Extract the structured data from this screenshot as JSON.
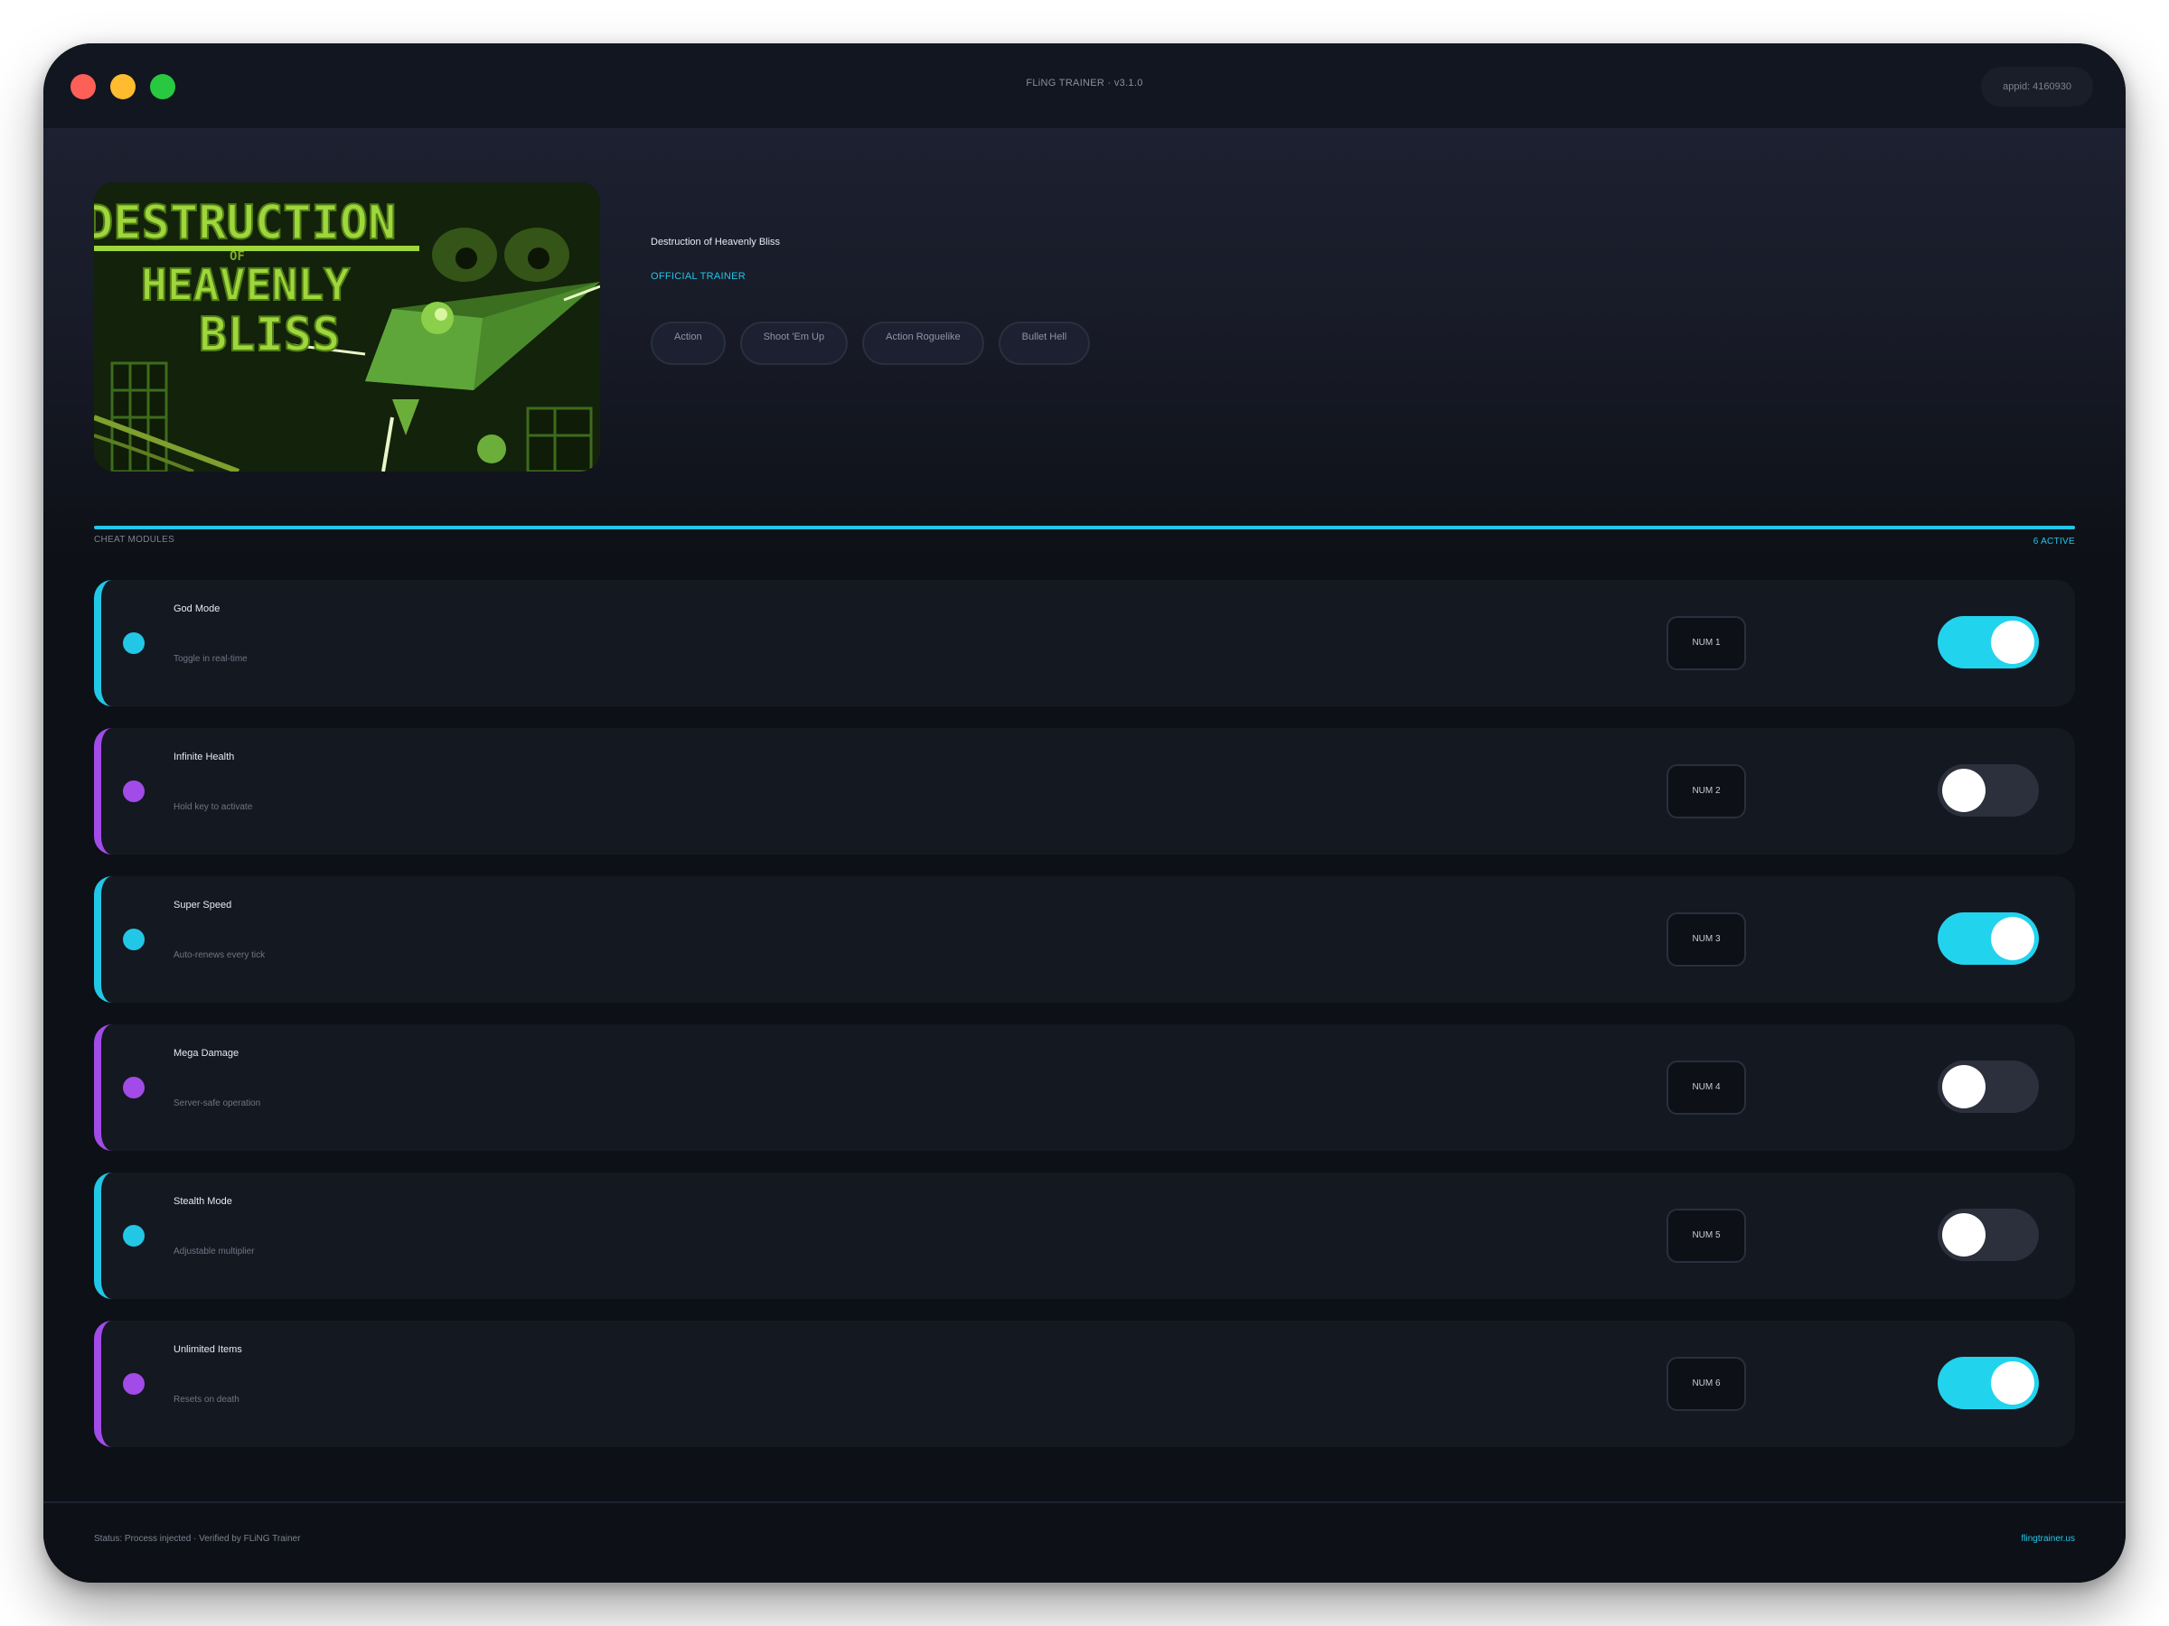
{
  "titlebar": {
    "title": "FLiNG TRAINER · v3.1.0",
    "appid": "appid: 4160930"
  },
  "game": {
    "title": "Destruction of Heavenly Bliss",
    "badge": "OFFICIAL TRAINER",
    "cover_title_lines": [
      "DESTRUCTION",
      "OF",
      "HEAVENLY",
      "BLISS"
    ],
    "tags": [
      "Action",
      "Shoot 'Em Up",
      "Action Roguelike",
      "Bullet Hell"
    ]
  },
  "modules_header": {
    "label": "CHEAT MODULES",
    "active_count": "6 ACTIVE"
  },
  "modules": [
    {
      "name": "God Mode",
      "desc": "Toggle in real-time",
      "hotkey": "NUM 1",
      "accent": "#22c7e6",
      "enabled": true
    },
    {
      "name": "Infinite Health",
      "desc": "Hold key to activate",
      "hotkey": "NUM 2",
      "accent": "#a24be8",
      "enabled": false
    },
    {
      "name": "Super Speed",
      "desc": "Auto-renews every tick",
      "hotkey": "NUM 3",
      "accent": "#22c7e6",
      "enabled": true
    },
    {
      "name": "Mega Damage",
      "desc": "Server-safe operation",
      "hotkey": "NUM 4",
      "accent": "#a24be8",
      "enabled": false
    },
    {
      "name": "Stealth Mode",
      "desc": "Adjustable multiplier",
      "hotkey": "NUM 5",
      "accent": "#22c7e6",
      "enabled": false
    },
    {
      "name": "Unlimited Items",
      "desc": "Resets on death",
      "hotkey": "NUM 6",
      "accent": "#a24be8",
      "enabled": true
    }
  ],
  "footer": {
    "status": "Status: Process injected · Verified by FLiNG Trainer",
    "site": "flingtrainer.us"
  },
  "colors": {
    "accent_cyan": "#22c7e6",
    "accent_purple": "#a24be8",
    "toggle_on": "#22d3ee",
    "toggle_off": "#2c303c",
    "background": "#0d1016"
  }
}
